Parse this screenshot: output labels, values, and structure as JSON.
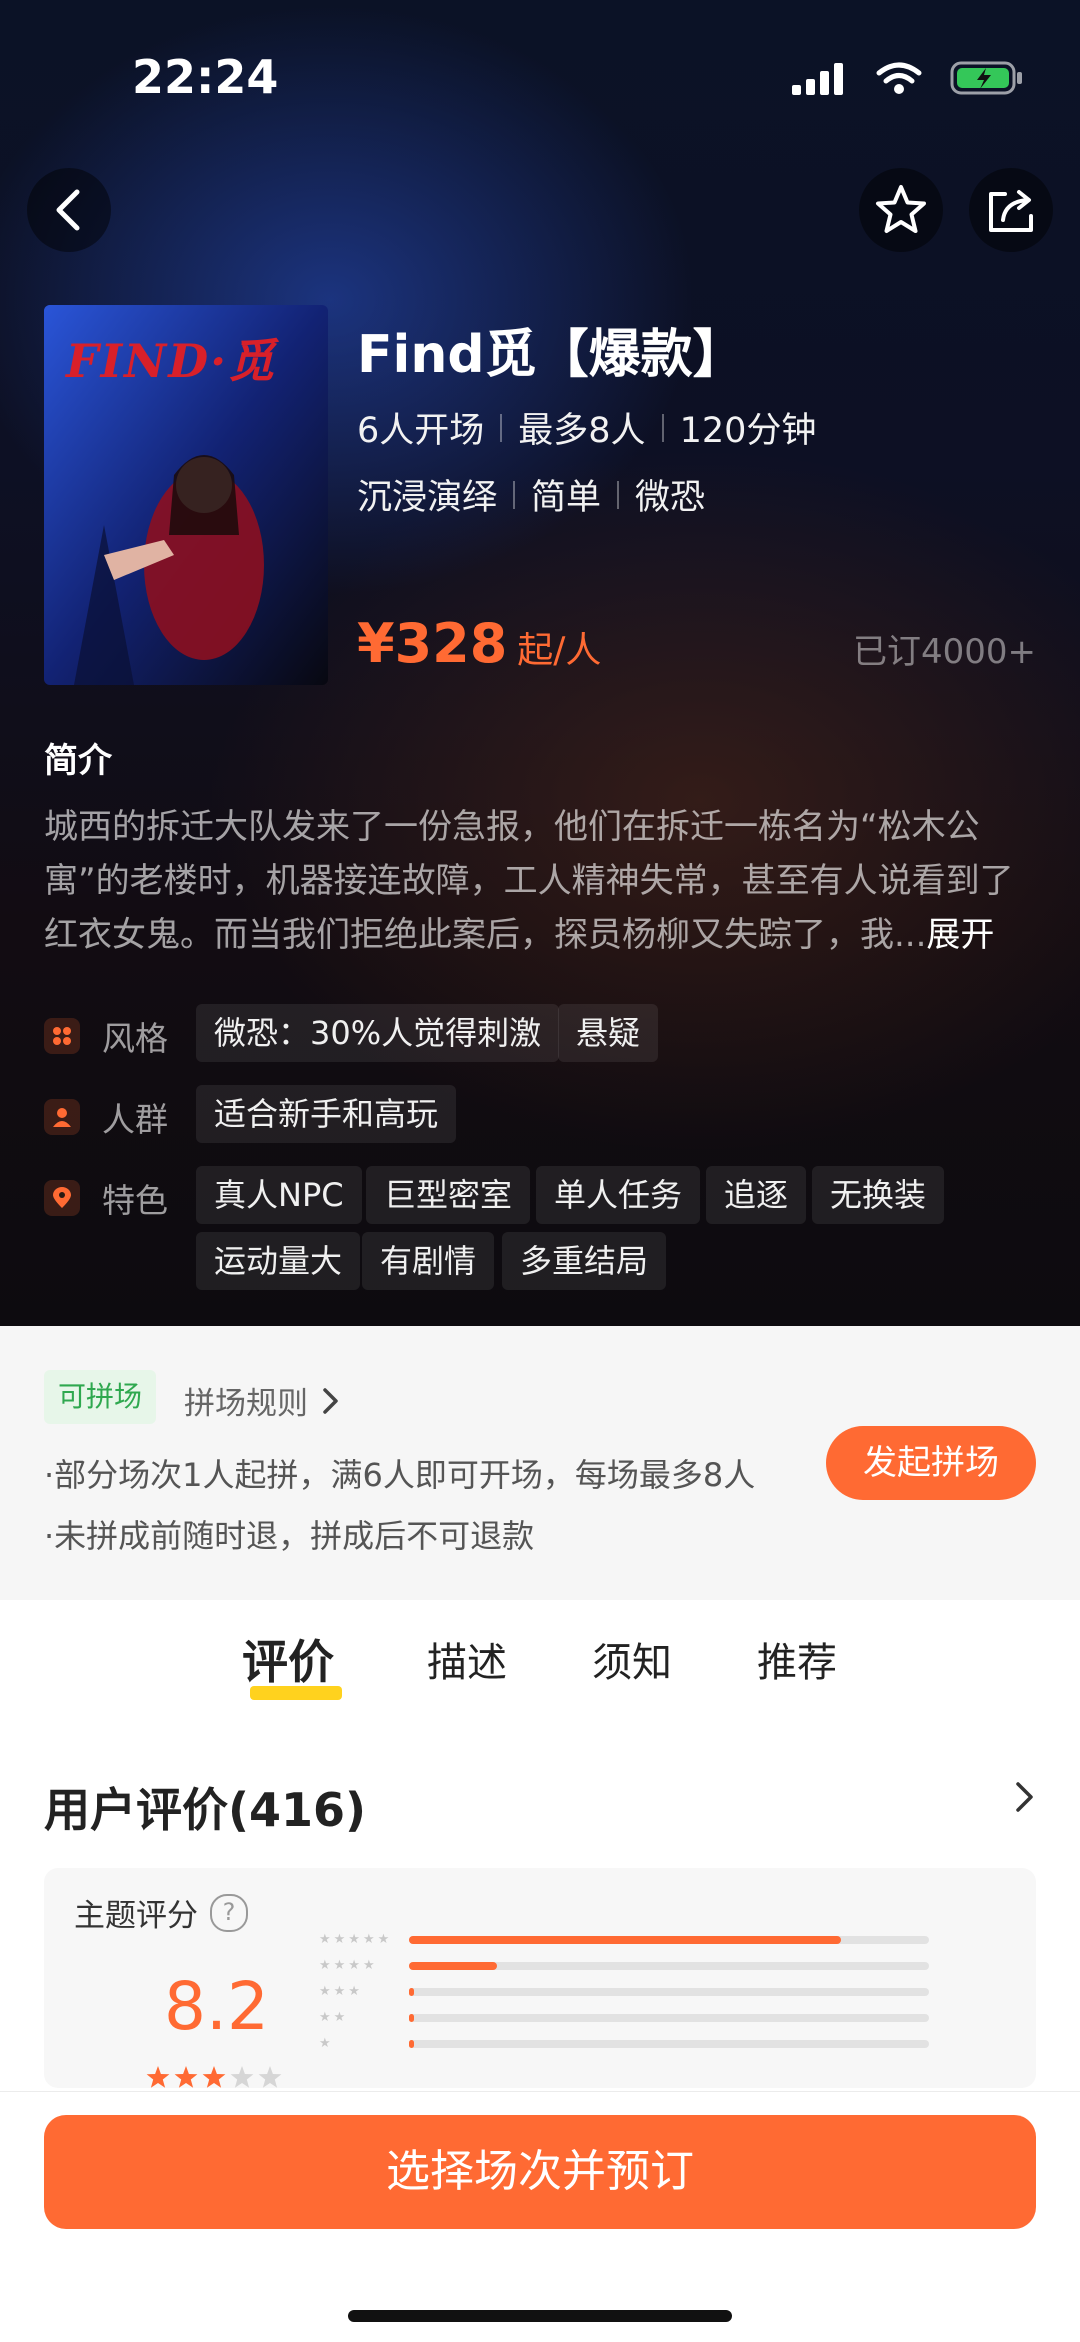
{
  "status_bar": {
    "time": "22:24"
  },
  "theme": {
    "title": "Find觅【爆款】",
    "meta_row1": [
      "6人开场",
      "最多8人",
      "120分钟"
    ],
    "meta_row2": [
      "沉浸演绎",
      "简单",
      "微恐"
    ],
    "price": "¥328",
    "price_unit": "起/人",
    "sold": "已订4000+",
    "cover_text": "FIND·觅"
  },
  "intro": {
    "heading": "简介",
    "text": "城西的拆迁大队发来了一份急报，他们在拆迁一栋名为“松木公寓”的老楼时，机器接连故障，工人精神失常，甚至有人说看到了红衣女鬼。而当我们拒绝此案后，探员杨柳又失踪了，我...",
    "more": "展开"
  },
  "attributes": {
    "style_label": "风格",
    "style_tags": [
      "微恐：30%人觉得刺激",
      "悬疑"
    ],
    "crowd_label": "人群",
    "crowd_tags": [
      "适合新手和高玩"
    ],
    "feature_label": "特色",
    "feature_tags_row1": [
      "真人NPC",
      "巨型密室",
      "单人任务",
      "追逐",
      "无换装"
    ],
    "feature_tags_row2": [
      "运动量大",
      "有剧情",
      "多重结局"
    ]
  },
  "group": {
    "badge": "可拼场",
    "rules": "拼场规则",
    "line1": "·部分场次1人起拼，满6人即可开场，每场最多8人",
    "line2": "·未拼成前随时退，拼成后不可退款",
    "button": "发起拼场"
  },
  "tabs": [
    "评价",
    "描述",
    "须知",
    "推荐"
  ],
  "reviews": {
    "title": "用户评价(416)",
    "rating_heading": "主题评分",
    "help": "?",
    "score": "8.2",
    "star_fill": 0.6,
    "bars": [
      0.83,
      0.17,
      0.01,
      0.01,
      0.01
    ]
  },
  "bottom": {
    "book": "选择场次并预订"
  },
  "colors": {
    "accent": "#ff6a33",
    "green": "#2fa84f",
    "tab_highlight": "#ffd21e"
  }
}
